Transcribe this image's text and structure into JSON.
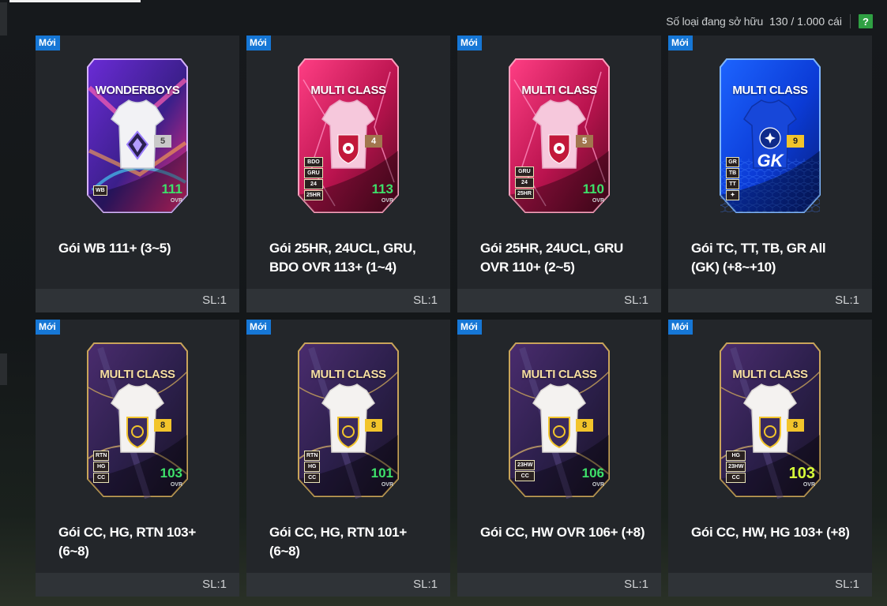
{
  "header": {
    "owned_label": "Số loại đang sở hữu",
    "owned_count": "130 / 1.000 cái",
    "help_label": "?"
  },
  "tiles": [
    {
      "badge": "Mới",
      "title": "Gói WB 111+ (3~5)",
      "qty": "SL:1",
      "card": {
        "theme": "wonder",
        "name": "WONDERBOYS",
        "num": "5",
        "ovr": "111",
        "ovr_label": "OVR",
        "tags": [
          "WB"
        ]
      }
    },
    {
      "badge": "Mới",
      "title": "Gói 25HR, 24UCL, GRU, BDO OVR 113+ (1~4)",
      "qty": "SL:1",
      "card": {
        "theme": "pink",
        "name": "MULTI CLASS",
        "num": "4",
        "ovr": "113",
        "ovr_label": "OVR",
        "tags": [
          "BDO",
          "GRU",
          "24",
          "25HR"
        ]
      }
    },
    {
      "badge": "Mới",
      "title": "Gói 25HR, 24UCL, GRU OVR 110+ (2~5)",
      "qty": "SL:1",
      "card": {
        "theme": "pink",
        "name": "MULTI CLASS",
        "num": "5",
        "ovr": "110",
        "ovr_label": "OVR",
        "tags": [
          "GRU",
          "24",
          "25HR"
        ]
      }
    },
    {
      "badge": "Mới",
      "title": "Gói TC, TT, TB, GR All (GK) (+8~+10)",
      "qty": "SL:1",
      "card": {
        "theme": "blue",
        "name": "MULTI CLASS",
        "num": "9",
        "ovr": "",
        "ovr_label": "",
        "gk": "GK",
        "tags": [
          "GR",
          "TB",
          "TT",
          "✦"
        ]
      }
    },
    {
      "badge": "Mới",
      "title": "Gói CC, HG, RTN 103+ (6~8)",
      "qty": "SL:1",
      "card": {
        "theme": "dark",
        "name": "MULTI CLASS",
        "num": "8",
        "ovr": "103",
        "ovr_label": "OVR",
        "tags": [
          "RTN",
          "HG",
          "CC"
        ]
      }
    },
    {
      "badge": "Mới",
      "title": "Gói CC, HG, RTN 101+ (6~8)",
      "qty": "SL:1",
      "card": {
        "theme": "dark",
        "name": "MULTI CLASS",
        "num": "8",
        "ovr": "101",
        "ovr_label": "OVR",
        "tags": [
          "RTN",
          "HG",
          "CC"
        ]
      }
    },
    {
      "badge": "Mới",
      "title": "Gói CC, HW OVR 106+ (+8)",
      "qty": "SL:1",
      "card": {
        "theme": "dark",
        "name": "MULTI CLASS",
        "num": "8",
        "ovr": "106",
        "ovr_label": "OVR",
        "tags": [
          "23HW",
          "CC"
        ]
      }
    },
    {
      "badge": "Mới",
      "title": "Gói CC, HW, HG 103+ (+8)",
      "qty": "SL:1",
      "card": {
        "theme": "dark",
        "name": "MULTI CLASS",
        "num": "8",
        "ovr": "103",
        "ovr_label": "OVR",
        "gold": true,
        "tags": [
          "HG",
          "23HW",
          "CC"
        ]
      }
    }
  ],
  "colors": {
    "new_badge": "#1677d6",
    "ovr_green": "#3ee06a",
    "help_green": "#2fa043"
  }
}
